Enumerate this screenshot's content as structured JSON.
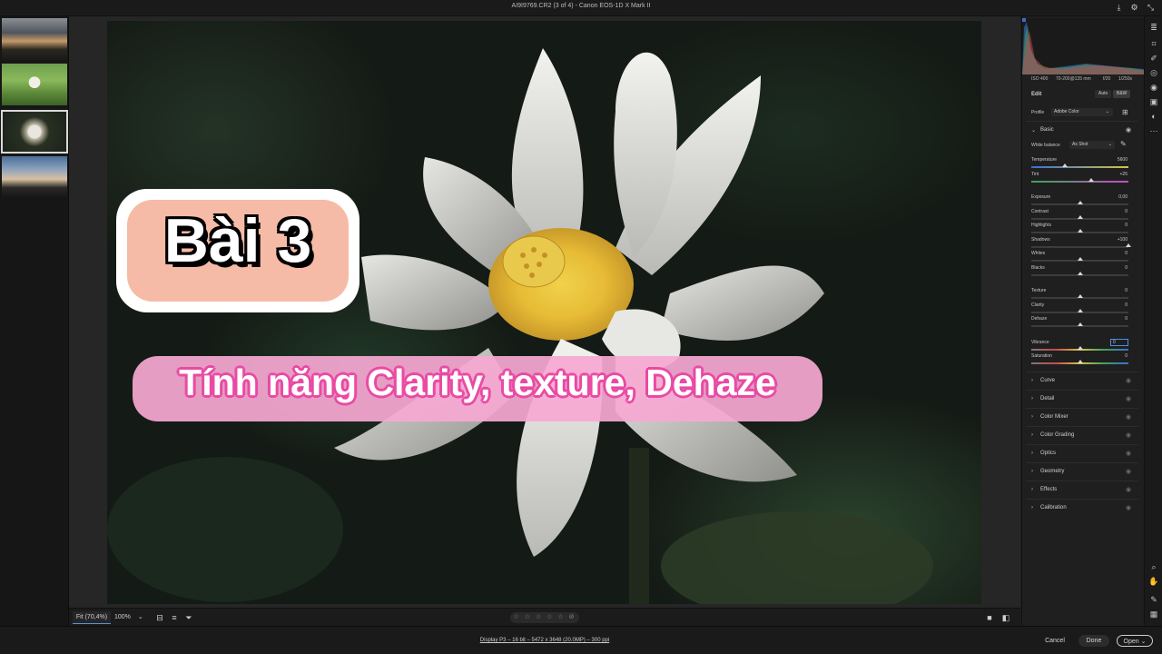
{
  "window": {
    "title": "AI9I9769.CR2 (3 of 4)  -  Canon EOS-1D X Mark II"
  },
  "titlebar_icons": [
    "download-icon",
    "gear-icon",
    "collapse-icon"
  ],
  "filmstrip": {
    "count": 4,
    "selected_index": 2
  },
  "overlay": {
    "lesson": "Bài 3",
    "subtitle": "Tính năng Clarity, texture, Dehaze"
  },
  "canvas_toolbar": {
    "fit": "Fit (70,4%)",
    "zoom": "100%",
    "zoom_caret": "⌄",
    "stars": "☆ ☆ ☆ ☆ ☆  ⊘"
  },
  "status": {
    "info": "Display P3 – 16 bit – 5472 x 3648 (20.0MP) – 300 ppi",
    "cancel": "Cancel",
    "done": "Done",
    "open": "Open",
    "open_caret": "⌄"
  },
  "camera": {
    "iso": "ISO 400",
    "lens": "70-200@135 mm",
    "aperture": "f/20",
    "shutter": "1/250s"
  },
  "edit": {
    "title": "Edit",
    "auto": "Auto",
    "bw": "B&W",
    "profile_label": "Profile",
    "profile_value": "Adobe Color",
    "profile_caret": "⌄",
    "basic": "Basic",
    "wb_label": "White balance",
    "wb_value": "As Shot",
    "wb_caret": "⌄",
    "sliders": [
      {
        "label": "Temperature",
        "value": "5600",
        "pos": 0.35
      },
      {
        "label": "Tint",
        "value": "+26",
        "pos": 0.62
      },
      {
        "label": "Exposure",
        "value": "0,00",
        "pos": 0.5
      },
      {
        "label": "Contrast",
        "value": "0",
        "pos": 0.5
      },
      {
        "label": "Highlights",
        "value": "0",
        "pos": 0.5
      },
      {
        "label": "Shadows",
        "value": "+100",
        "pos": 1.0
      },
      {
        "label": "Whites",
        "value": "0",
        "pos": 0.5
      },
      {
        "label": "Blacks",
        "value": "0",
        "pos": 0.5
      },
      {
        "label": "Texture",
        "value": "0",
        "pos": 0.5
      },
      {
        "label": "Clarity",
        "value": "0",
        "pos": 0.5
      },
      {
        "label": "Dehaze",
        "value": "0",
        "pos": 0.5
      },
      {
        "label": "Vibrance",
        "value": "0",
        "pos": 0.5
      },
      {
        "label": "Saturation",
        "value": "0",
        "pos": 0.5
      }
    ],
    "sections": [
      "Curve",
      "Detail",
      "Color Mixer",
      "Color Grading",
      "Optics",
      "Geometry",
      "Effects",
      "Calibration"
    ]
  },
  "colors": {
    "accent": "#4d8ee8",
    "pink": "#f7a8d2",
    "peach": "#f6bba6"
  }
}
